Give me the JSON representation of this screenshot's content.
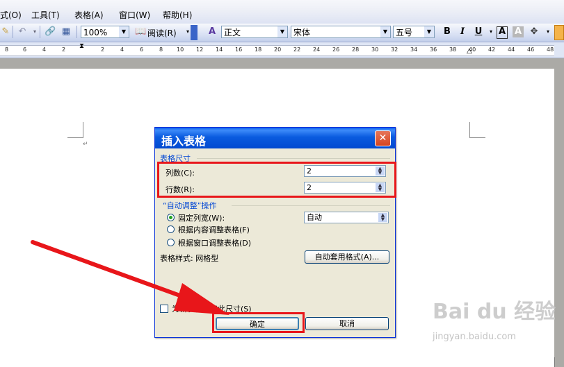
{
  "menu": {
    "items": [
      {
        "label": "式(O)"
      },
      {
        "label": "工具(T)"
      },
      {
        "label": "表格(A)"
      },
      {
        "label": "窗口(W)"
      },
      {
        "label": "帮助(H)"
      }
    ]
  },
  "toolbar": {
    "zoom": "100%",
    "read_label": "阅读(R)",
    "style": "正文",
    "font": "宋体",
    "size": "五号",
    "bold": "B",
    "italic": "I",
    "underline": "U",
    "border_a": "A",
    "shade_a": "A"
  },
  "ruler": {
    "ticks": [
      "8",
      "6",
      "4",
      "2",
      "2",
      "4",
      "6",
      "8",
      "10",
      "12",
      "14",
      "16",
      "18",
      "20",
      "22",
      "24",
      "26",
      "28",
      "30",
      "32",
      "34",
      "36",
      "38",
      "40",
      "42",
      "44",
      "46",
      "48"
    ]
  },
  "dialog": {
    "title": "插入表格",
    "size_group": "表格尺寸",
    "cols_label": "列数(C):",
    "cols_value": "2",
    "rows_label": "行数(R):",
    "rows_value": "2",
    "autofit_group": "“自动调整”操作",
    "opt_fixed": "固定列宽(W):",
    "fixed_value": "自动",
    "opt_content": "根据内容调整表格(F)",
    "opt_window": "根据窗口调整表格(D)",
    "style_label": "表格样式: 网格型",
    "autoformat_button": "自动套用格式(A)...",
    "remember_label": "为新表格记忆此尺寸(S)",
    "ok_button": "确定",
    "cancel_button": "取消"
  },
  "watermark": {
    "text": "Bai du 经验",
    "url": "jingyan.baidu.com"
  },
  "colors": {
    "annotation_red": "#e8161a",
    "title_blue": "#0a5bdf",
    "group_blue": "#0046d5"
  }
}
